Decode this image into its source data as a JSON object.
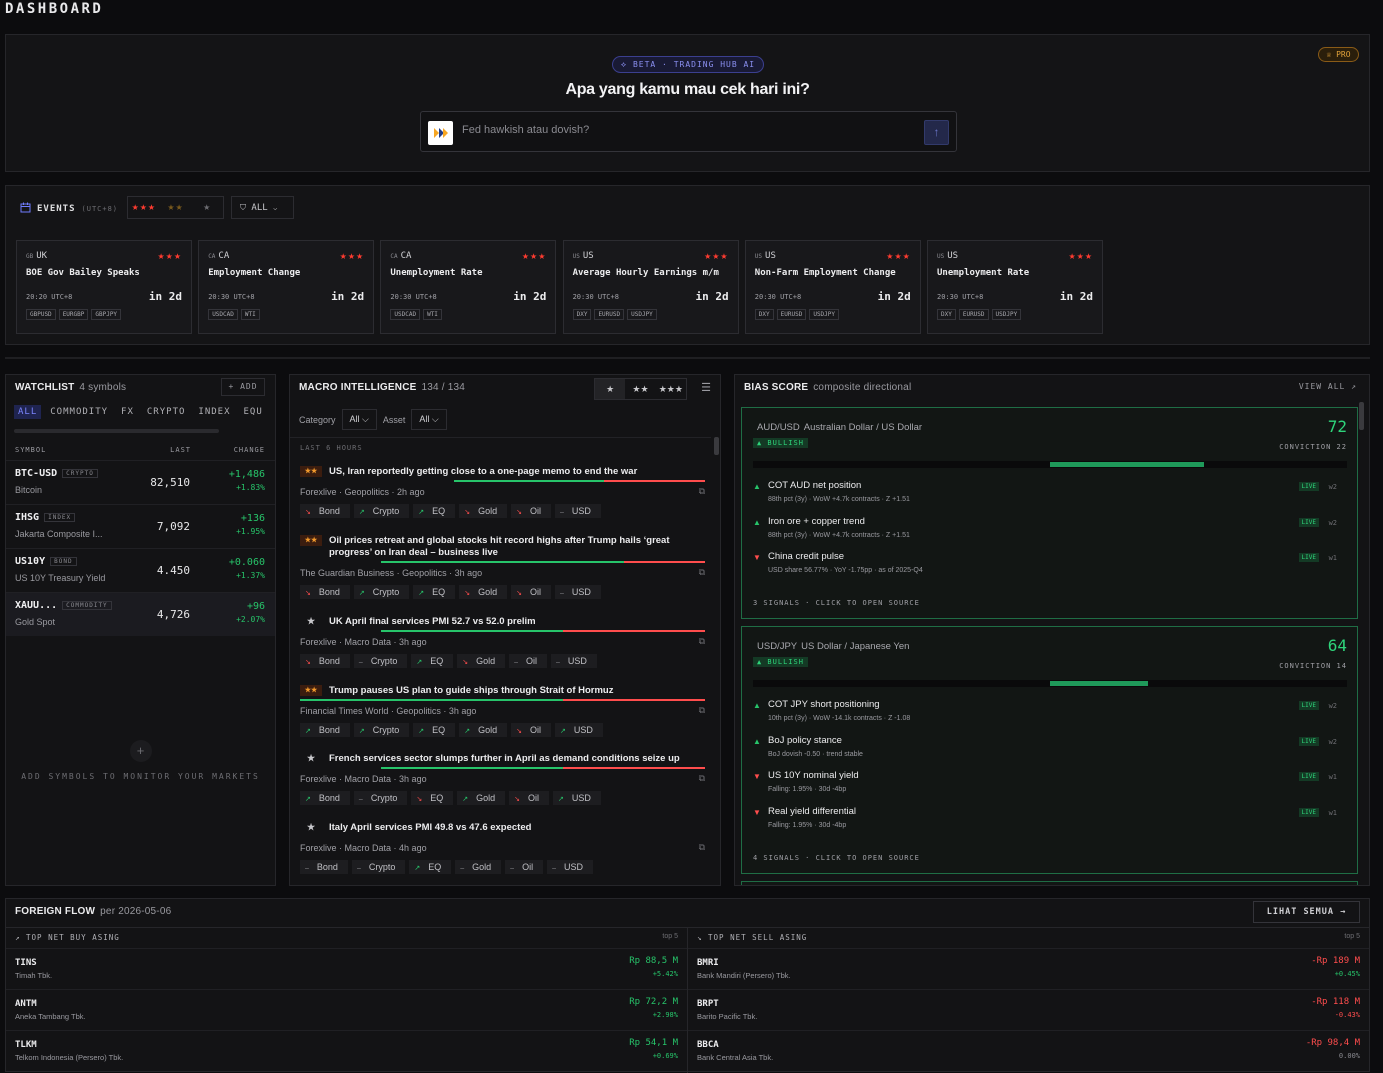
{
  "page_title": "DASHBOARD",
  "hero": {
    "beta_label": "⟡ BETA · TRADING HUB AI",
    "pro_label": "♕ PRO",
    "question": "Apa yang kamu mau cek hari ini?",
    "input_placeholder": "Fed hawkish atau dovish?",
    "send_icon": "↑"
  },
  "events": {
    "title": "EVENTS",
    "timezone": "(UTC+8)",
    "filter_stars": [
      "★★★",
      "★★",
      "★"
    ],
    "all_label": "ALL",
    "items": [
      {
        "flag": "GB",
        "country": "UK",
        "impact": "★★★",
        "name": "BOE Gov Bailey Speaks",
        "time": "20:20 UTC+8",
        "in": "in 2d",
        "tags": [
          "GBPUSD",
          "EURGBP",
          "GBPJPY"
        ]
      },
      {
        "flag": "CA",
        "country": "CA",
        "impact": "★★★",
        "name": "Employment Change",
        "time": "20:30 UTC+8",
        "in": "in 2d",
        "tags": [
          "USDCAD",
          "WTI"
        ]
      },
      {
        "flag": "CA",
        "country": "CA",
        "impact": "★★★",
        "name": "Unemployment Rate",
        "time": "20:30 UTC+8",
        "in": "in 2d",
        "tags": [
          "USDCAD",
          "WTI"
        ]
      },
      {
        "flag": "US",
        "country": "US",
        "impact": "★★★",
        "name": "Average Hourly Earnings m/m",
        "time": "20:30 UTC+8",
        "in": "in 2d",
        "tags": [
          "DXY",
          "EURUSD",
          "USDJPY"
        ]
      },
      {
        "flag": "US",
        "country": "US",
        "impact": "★★★",
        "name": "Non-Farm Employment Change",
        "time": "20:30 UTC+8",
        "in": "in 2d",
        "tags": [
          "DXY",
          "EURUSD",
          "USDJPY"
        ]
      },
      {
        "flag": "US",
        "country": "US",
        "impact": "★★★",
        "name": "Unemployment Rate",
        "time": "20:30 UTC+8",
        "in": "in 2d",
        "tags": [
          "DXY",
          "EURUSD",
          "USDJPY"
        ]
      }
    ]
  },
  "watchlist": {
    "title": "WATCHLIST",
    "count": "4 symbols",
    "add_label": "+ ADD",
    "tabs": [
      "ALL",
      "COMMODITY",
      "FX",
      "CRYPTO",
      "INDEX",
      "EQU"
    ],
    "col_symbol": "SYMBOL",
    "col_last": "LAST",
    "col_change": "CHANGE",
    "rows": [
      {
        "symbol": "BTC-USD",
        "kind": "CRYPTO",
        "desc": "Bitcoin",
        "last": "82,510",
        "chg": "+1,486",
        "pct": "+1.83%"
      },
      {
        "symbol": "IHSG",
        "kind": "INDEX",
        "desc": "Jakarta Composite I...",
        "last": "7,092",
        "chg": "+136",
        "pct": "+1.95%"
      },
      {
        "symbol": "US10Y",
        "kind": "BOND",
        "desc": "US 10Y Treasury Yield",
        "last": "4.450",
        "chg": "+0.060",
        "pct": "+1.37%"
      },
      {
        "symbol": "XAUU...",
        "kind": "COMMODITY",
        "desc": "Gold Spot",
        "last": "4,726",
        "chg": "+96",
        "pct": "+2.07%"
      }
    ],
    "empty_plus": "+",
    "empty_text": "ADD SYMBOLS TO MONITOR YOUR MARKETS"
  },
  "macro": {
    "title": "MACRO INTELLIGENCE",
    "count": "134 / 134",
    "star_filters": [
      "★",
      "★★",
      "★★★"
    ],
    "menu_icon": "☰",
    "category_label": "Category",
    "category_value": "All",
    "asset_label": "Asset",
    "asset_value": "All",
    "section_label": "LAST 6 HOURS",
    "news": [
      {
        "stars": "★★",
        "headline": "US, Iran reportedly getting close to a one-page memo to end the war",
        "source": "Forexlive",
        "category": "Geopolitics",
        "ago": "2h ago",
        "chips": [
          {
            "a": "↘",
            "l": "Bond",
            "d": "dn"
          },
          {
            "a": "↗",
            "l": "Crypto",
            "d": "up"
          },
          {
            "a": "↗",
            "l": "EQ",
            "d": "up"
          },
          {
            "a": "↘",
            "l": "Gold",
            "d": "dn"
          },
          {
            "a": "↘",
            "l": "Oil",
            "d": "dn"
          },
          {
            "a": "–",
            "l": "USD",
            "d": "fl"
          }
        ]
      },
      {
        "stars": "★★",
        "headline": "Oil prices retreat and global stocks hit record highs after Trump hails ‘great progress’ on Iran deal – business live",
        "source": "The Guardian Business",
        "category": "Geopolitics",
        "ago": "3h ago",
        "chips": [
          {
            "a": "↘",
            "l": "Bond",
            "d": "dn"
          },
          {
            "a": "↗",
            "l": "Crypto",
            "d": "up"
          },
          {
            "a": "↗",
            "l": "EQ",
            "d": "up"
          },
          {
            "a": "↘",
            "l": "Gold",
            "d": "dn"
          },
          {
            "a": "↘",
            "l": "Oil",
            "d": "dn"
          },
          {
            "a": "–",
            "l": "USD",
            "d": "fl"
          }
        ]
      },
      {
        "stars": "★",
        "headline": "UK April final services PMI 52.7 vs 52.0 prelim",
        "source": "Forexlive",
        "category": "Macro Data",
        "ago": "3h ago",
        "chips": [
          {
            "a": "↘",
            "l": "Bond",
            "d": "dn"
          },
          {
            "a": "–",
            "l": "Crypto",
            "d": "fl"
          },
          {
            "a": "↗",
            "l": "EQ",
            "d": "up"
          },
          {
            "a": "↘",
            "l": "Gold",
            "d": "dn"
          },
          {
            "a": "–",
            "l": "Oil",
            "d": "fl"
          },
          {
            "a": "–",
            "l": "USD",
            "d": "fl"
          }
        ]
      },
      {
        "stars": "★★",
        "headline": "Trump pauses US plan to guide ships through Strait of Hormuz",
        "source": "Financial Times World",
        "category": "Geopolitics",
        "ago": "3h ago",
        "chips": [
          {
            "a": "↗",
            "l": "Bond",
            "d": "up"
          },
          {
            "a": "↗",
            "l": "Crypto",
            "d": "up"
          },
          {
            "a": "↗",
            "l": "EQ",
            "d": "up"
          },
          {
            "a": "↗",
            "l": "Gold",
            "d": "up"
          },
          {
            "a": "↘",
            "l": "Oil",
            "d": "dn"
          },
          {
            "a": "↗",
            "l": "USD",
            "d": "up"
          }
        ]
      },
      {
        "stars": "★",
        "headline": "French services sector slumps further in April as demand conditions seize up",
        "source": "Forexlive",
        "category": "Macro Data",
        "ago": "3h ago",
        "chips": [
          {
            "a": "↗",
            "l": "Bond",
            "d": "up"
          },
          {
            "a": "–",
            "l": "Crypto",
            "d": "fl"
          },
          {
            "a": "↘",
            "l": "EQ",
            "d": "dn"
          },
          {
            "a": "↗",
            "l": "Gold",
            "d": "up"
          },
          {
            "a": "↘",
            "l": "Oil",
            "d": "dn"
          },
          {
            "a": "↗",
            "l": "USD",
            "d": "up"
          }
        ]
      },
      {
        "stars": "★",
        "headline": "Italy April services PMI 49.8 vs 47.6 expected",
        "source": "Forexlive",
        "category": "Macro Data",
        "ago": "4h ago",
        "chips": [
          {
            "a": "–",
            "l": "Bond",
            "d": "fl"
          },
          {
            "a": "–",
            "l": "Crypto",
            "d": "fl"
          },
          {
            "a": "↗",
            "l": "EQ",
            "d": "up"
          },
          {
            "a": "–",
            "l": "Gold",
            "d": "fl"
          },
          {
            "a": "–",
            "l": "Oil",
            "d": "fl"
          },
          {
            "a": "–",
            "l": "USD",
            "d": "fl"
          }
        ]
      }
    ]
  },
  "bias": {
    "title": "BIAS SCORE",
    "subtitle": "composite directional",
    "view_all": "VIEW ALL ↗",
    "cards": [
      {
        "pair": "AUD/USD",
        "name": "Australian Dollar / US Dollar",
        "bias": "▲ BULLISH",
        "score": "72",
        "conviction": "CONVICTION 22",
        "meter_fraction": 0.22,
        "signals": [
          {
            "dir": "▲",
            "d": "up",
            "name": "COT AUD net position",
            "meta": "88th pct (3y) · WoW +4.7k contracts · Z +1.51",
            "live": "LIVE",
            "w": "w2"
          },
          {
            "dir": "▲",
            "d": "up",
            "name": "Iron ore + copper trend",
            "meta": "88th pct (3y) · WoW +4.7k contracts · Z +1.51",
            "live": "LIVE",
            "w": "w2"
          },
          {
            "dir": "▼",
            "d": "dn",
            "name": "China credit pulse",
            "meta": "USD share 56.77% · YoY -1.75pp · as of 2025-Q4",
            "live": "LIVE",
            "w": "w1"
          }
        ],
        "footer": "3 SIGNALS · CLICK TO OPEN SOURCE"
      },
      {
        "pair": "USD/JPY",
        "name": "US Dollar / Japanese Yen",
        "bias": "▲ BULLISH",
        "score": "64",
        "conviction": "CONVICTION 14",
        "meter_fraction": 0.14,
        "signals": [
          {
            "dir": "▲",
            "d": "up",
            "name": "COT JPY short positioning",
            "meta": "10th pct (3y) · WoW -14.1k contracts · Z -1.08",
            "live": "LIVE",
            "w": "w2"
          },
          {
            "dir": "▲",
            "d": "up",
            "name": "BoJ policy stance",
            "meta": "BoJ dovish -0.50 · trend stable",
            "live": "LIVE",
            "w": "w2"
          },
          {
            "dir": "▼",
            "d": "dn",
            "name": "US 10Y nominal yield",
            "meta": "Falling: 1.95% · 30d -4bp",
            "live": "LIVE",
            "w": "w1"
          },
          {
            "dir": "▼",
            "d": "dn",
            "name": "Real yield differential",
            "meta": "Falling: 1.95% · 30d -4bp",
            "live": "LIVE",
            "w": "w1"
          }
        ],
        "footer": "4 SIGNALS · CLICK TO OPEN SOURCE"
      }
    ]
  },
  "foreign_flow": {
    "title": "FOREIGN FLOW",
    "date": "per 2026-05-06",
    "see_all": "LIHAT SEMUA →",
    "buy_title": "↗ TOP NET BUY ASING",
    "sell_title": "↘ TOP NET SELL ASING",
    "top_label": "top 5",
    "buy": [
      {
        "ticker": "TINS",
        "name": "Timah Tbk.",
        "value": "Rp 88,5 M",
        "pct": "+5.42%"
      },
      {
        "ticker": "ANTM",
        "name": "Aneka Tambang Tbk.",
        "value": "Rp 72,2 M",
        "pct": "+2.98%"
      },
      {
        "ticker": "TLKM",
        "name": "Telkom Indonesia (Persero) Tbk.",
        "value": "Rp 54,1 M",
        "pct": "+0.69%"
      }
    ],
    "sell": [
      {
        "ticker": "BMRI",
        "name": "Bank Mandiri (Persero) Tbk.",
        "value": "-Rp 189 M",
        "pct": "+0.45%",
        "pd": "up"
      },
      {
        "ticker": "BRPT",
        "name": "Barito Pacific Tbk.",
        "value": "-Rp 118 M",
        "pct": "-0.43%",
        "pd": "dn"
      },
      {
        "ticker": "BBCA",
        "name": "Bank Central Asia Tbk.",
        "value": "-Rp 98,4 M",
        "pct": "0.00%",
        "pd": "fl"
      }
    ]
  },
  "colors": {
    "accent": "#7c86ff",
    "up": "#27c46a",
    "down": "#ff4d4d",
    "star": "#ff3b30",
    "amber": "#f39a2c"
  }
}
